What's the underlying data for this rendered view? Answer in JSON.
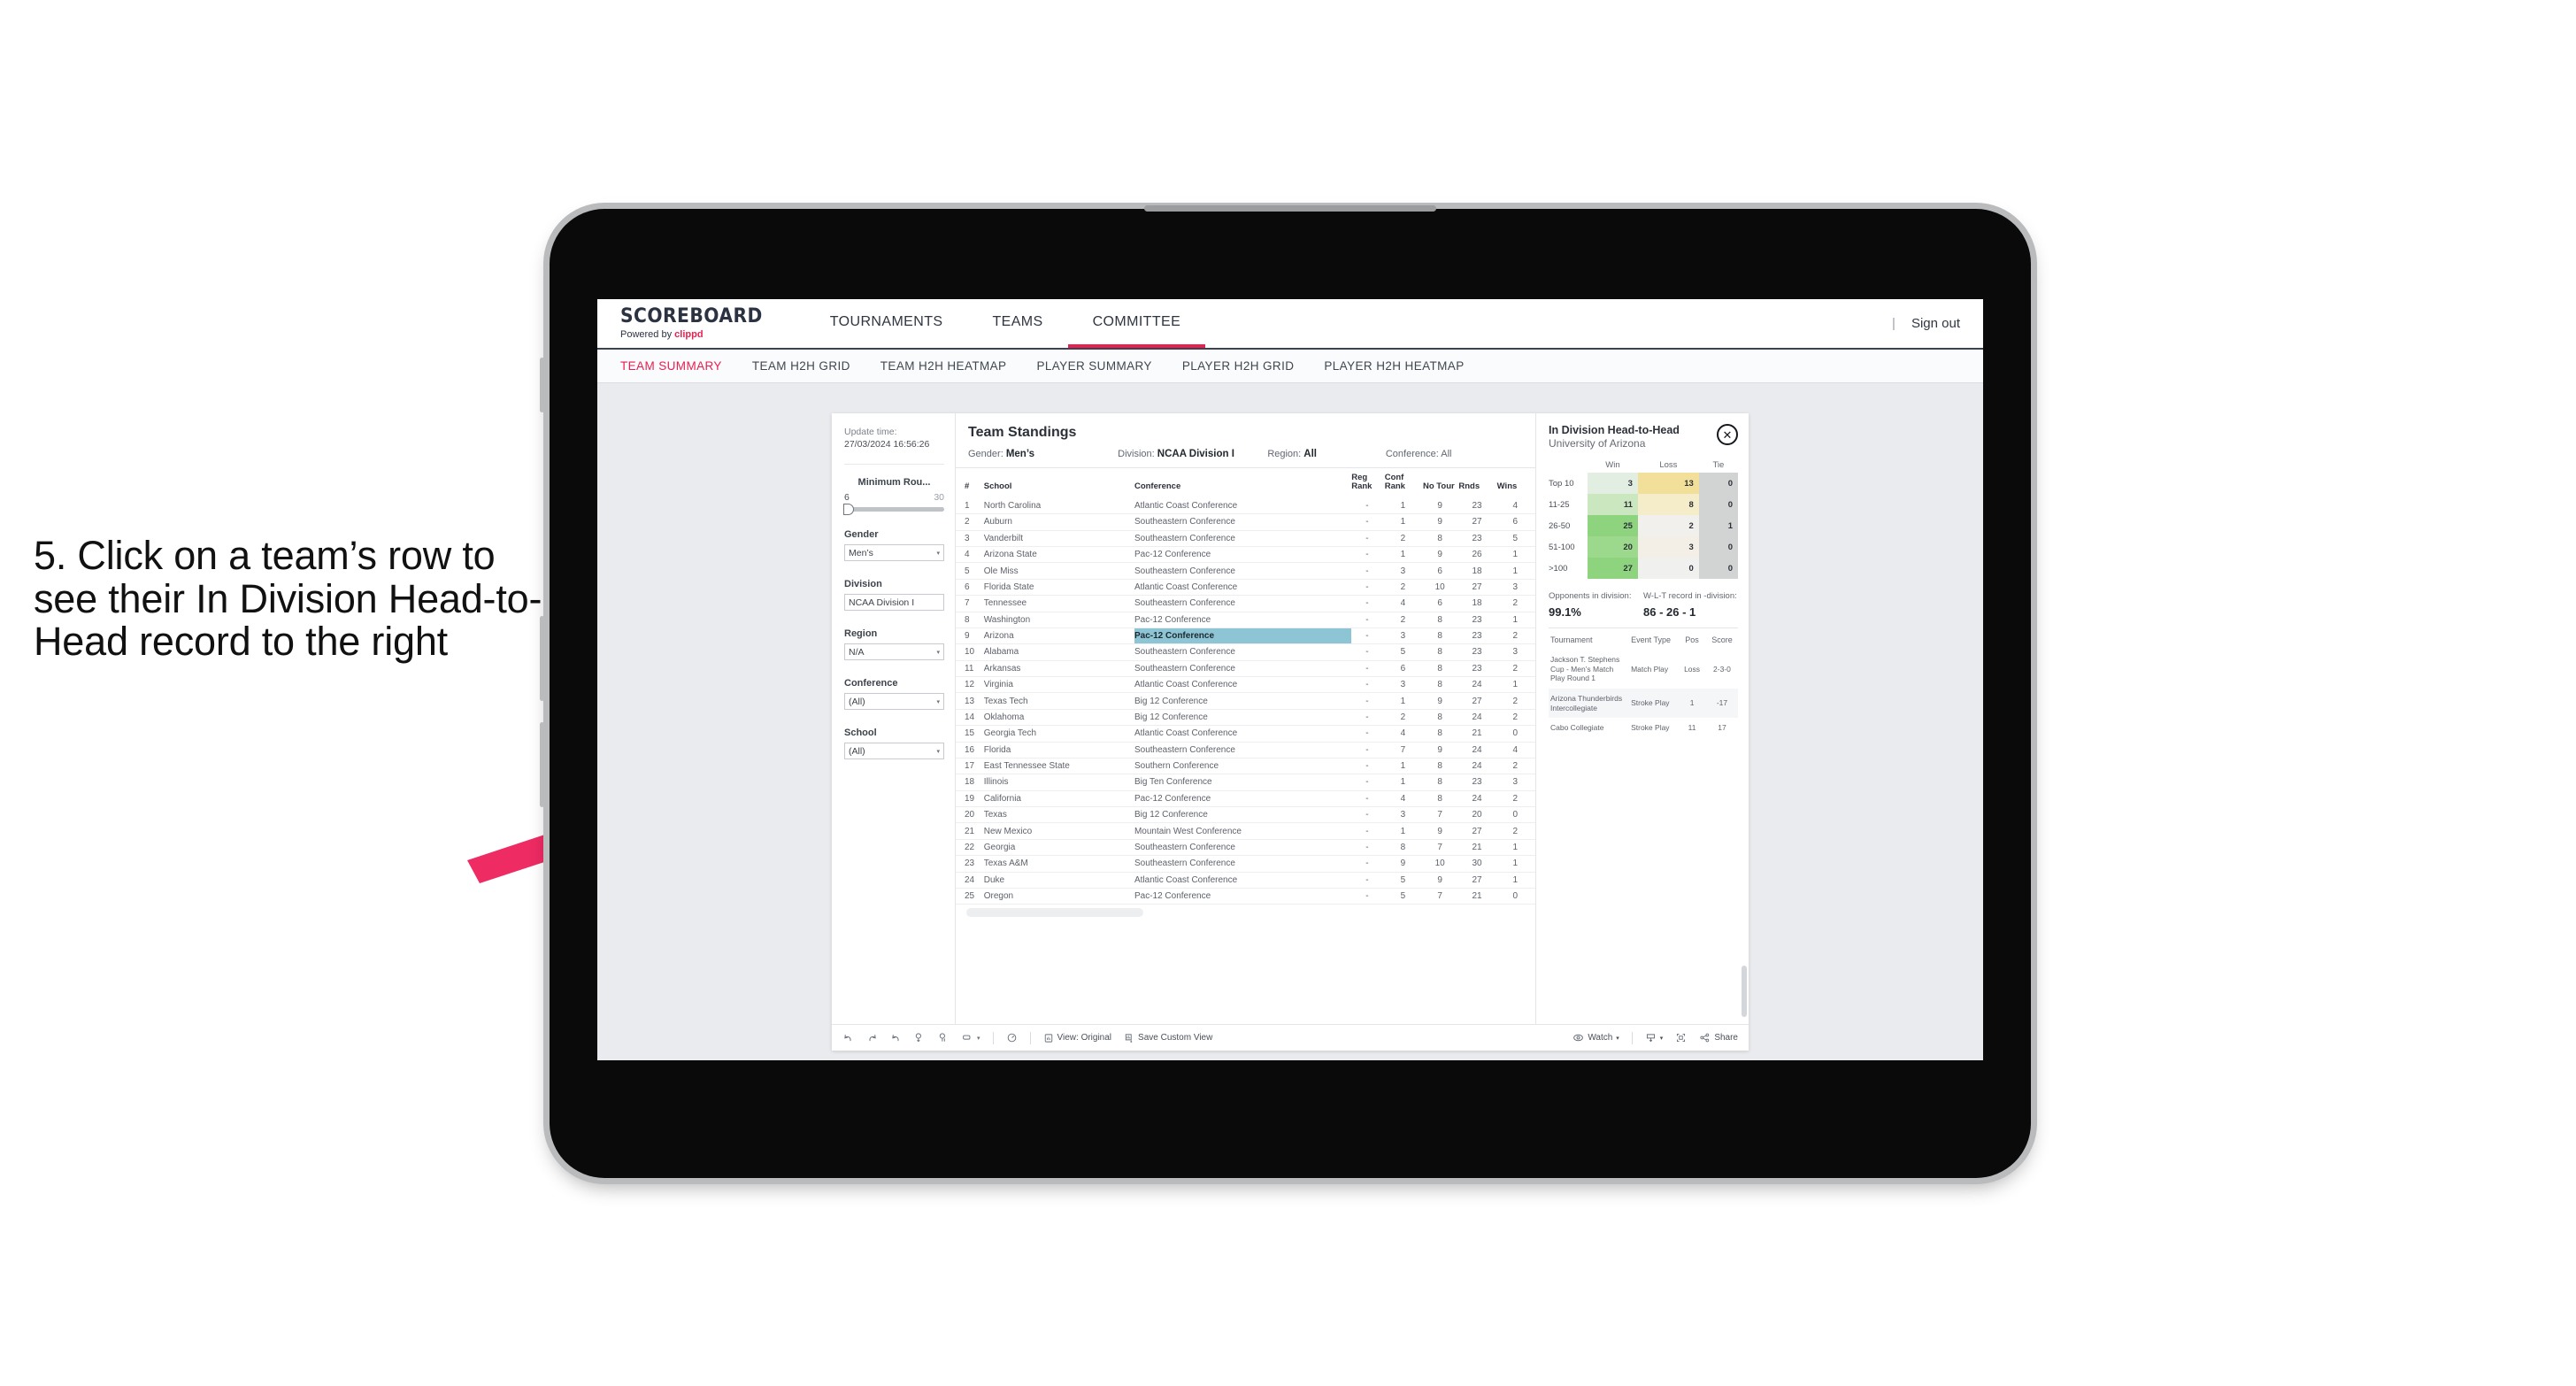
{
  "caption": "5. Click on a team’s row to see their In Division Head-to-Head record to the right",
  "header": {
    "logo_word": "SCOREBOARD",
    "logo_powered": "Powered by ",
    "logo_brand": "clippd",
    "nav": [
      {
        "label": "TOURNAMENTS",
        "active": false
      },
      {
        "label": "TEAMS",
        "active": false
      },
      {
        "label": "COMMITTEE",
        "active": true
      }
    ],
    "separator": "|",
    "signout": "Sign out"
  },
  "subtabs": [
    {
      "label": "TEAM SUMMARY",
      "active": true
    },
    {
      "label": "TEAM H2H GRID",
      "active": false
    },
    {
      "label": "TEAM H2H HEATMAP",
      "active": false
    },
    {
      "label": "PLAYER SUMMARY",
      "active": false
    },
    {
      "label": "PLAYER H2H GRID",
      "active": false
    },
    {
      "label": "PLAYER H2H HEATMAP",
      "active": false
    }
  ],
  "filters": {
    "update_label": "Update time:",
    "update_value": "27/03/2024 16:56:26",
    "slider": {
      "title": "Minimum Rou...",
      "min": "6",
      "max": "30"
    },
    "groups": [
      {
        "title": "Gender",
        "value": "Men’s"
      },
      {
        "title": "Division",
        "value": "NCAA Division I"
      },
      {
        "title": "Region",
        "value": "N/A"
      },
      {
        "title": "Conference",
        "value": "(All)"
      },
      {
        "title": "School",
        "value": "(All)"
      }
    ],
    "caret": "▾"
  },
  "standings": {
    "title": "Team Standings",
    "filters": [
      {
        "label": "Gender: ",
        "value": "Men’s"
      },
      {
        "label": "Division: ",
        "value": "NCAA Division I"
      },
      {
        "label": "Region: ",
        "value": "All"
      },
      {
        "label": "Conference: ",
        "value": "All"
      }
    ],
    "columns": [
      "#",
      "School",
      "Conference",
      "Reg Rank",
      "Conf Rank",
      "No Tour",
      "Rnds",
      "Wins"
    ],
    "selected_row": 9,
    "rows": [
      {
        "num": "1",
        "school": "North Carolina",
        "conf": "Atlantic Coast Conference",
        "reg": "-",
        "cr": "1",
        "nt": "9",
        "rn": "23",
        "wi": "4"
      },
      {
        "num": "2",
        "school": "Auburn",
        "conf": "Southeastern Conference",
        "reg": "-",
        "cr": "1",
        "nt": "9",
        "rn": "27",
        "wi": "6"
      },
      {
        "num": "3",
        "school": "Vanderbilt",
        "conf": "Southeastern Conference",
        "reg": "-",
        "cr": "2",
        "nt": "8",
        "rn": "23",
        "wi": "5"
      },
      {
        "num": "4",
        "school": "Arizona State",
        "conf": "Pac-12 Conference",
        "reg": "-",
        "cr": "1",
        "nt": "9",
        "rn": "26",
        "wi": "1"
      },
      {
        "num": "5",
        "school": "Ole Miss",
        "conf": "Southeastern Conference",
        "reg": "-",
        "cr": "3",
        "nt": "6",
        "rn": "18",
        "wi": "1"
      },
      {
        "num": "6",
        "school": "Florida State",
        "conf": "Atlantic Coast Conference",
        "reg": "-",
        "cr": "2",
        "nt": "10",
        "rn": "27",
        "wi": "3"
      },
      {
        "num": "7",
        "school": "Tennessee",
        "conf": "Southeastern Conference",
        "reg": "-",
        "cr": "4",
        "nt": "6",
        "rn": "18",
        "wi": "2"
      },
      {
        "num": "8",
        "school": "Washington",
        "conf": "Pac-12 Conference",
        "reg": "-",
        "cr": "2",
        "nt": "8",
        "rn": "23",
        "wi": "1"
      },
      {
        "num": "9",
        "school": "Arizona",
        "conf": "Pac-12 Conference",
        "reg": "-",
        "cr": "3",
        "nt": "8",
        "rn": "23",
        "wi": "2"
      },
      {
        "num": "10",
        "school": "Alabama",
        "conf": "Southeastern Conference",
        "reg": "-",
        "cr": "5",
        "nt": "8",
        "rn": "23",
        "wi": "3"
      },
      {
        "num": "11",
        "school": "Arkansas",
        "conf": "Southeastern Conference",
        "reg": "-",
        "cr": "6",
        "nt": "8",
        "rn": "23",
        "wi": "2"
      },
      {
        "num": "12",
        "school": "Virginia",
        "conf": "Atlantic Coast Conference",
        "reg": "-",
        "cr": "3",
        "nt": "8",
        "rn": "24",
        "wi": "1"
      },
      {
        "num": "13",
        "school": "Texas Tech",
        "conf": "Big 12 Conference",
        "reg": "-",
        "cr": "1",
        "nt": "9",
        "rn": "27",
        "wi": "2"
      },
      {
        "num": "14",
        "school": "Oklahoma",
        "conf": "Big 12 Conference",
        "reg": "-",
        "cr": "2",
        "nt": "8",
        "rn": "24",
        "wi": "2"
      },
      {
        "num": "15",
        "school": "Georgia Tech",
        "conf": "Atlantic Coast Conference",
        "reg": "-",
        "cr": "4",
        "nt": "8",
        "rn": "21",
        "wi": "0"
      },
      {
        "num": "16",
        "school": "Florida",
        "conf": "Southeastern Conference",
        "reg": "-",
        "cr": "7",
        "nt": "9",
        "rn": "24",
        "wi": "4"
      },
      {
        "num": "17",
        "school": "East Tennessee State",
        "conf": "Southern Conference",
        "reg": "-",
        "cr": "1",
        "nt": "8",
        "rn": "24",
        "wi": "2"
      },
      {
        "num": "18",
        "school": "Illinois",
        "conf": "Big Ten Conference",
        "reg": "-",
        "cr": "1",
        "nt": "8",
        "rn": "23",
        "wi": "3"
      },
      {
        "num": "19",
        "school": "California",
        "conf": "Pac-12 Conference",
        "reg": "-",
        "cr": "4",
        "nt": "8",
        "rn": "24",
        "wi": "2"
      },
      {
        "num": "20",
        "school": "Texas",
        "conf": "Big 12 Conference",
        "reg": "-",
        "cr": "3",
        "nt": "7",
        "rn": "20",
        "wi": "0"
      },
      {
        "num": "21",
        "school": "New Mexico",
        "conf": "Mountain West Conference",
        "reg": "-",
        "cr": "1",
        "nt": "9",
        "rn": "27",
        "wi": "2"
      },
      {
        "num": "22",
        "school": "Georgia",
        "conf": "Southeastern Conference",
        "reg": "-",
        "cr": "8",
        "nt": "7",
        "rn": "21",
        "wi": "1"
      },
      {
        "num": "23",
        "school": "Texas A&M",
        "conf": "Southeastern Conference",
        "reg": "-",
        "cr": "9",
        "nt": "10",
        "rn": "30",
        "wi": "1"
      },
      {
        "num": "24",
        "school": "Duke",
        "conf": "Atlantic Coast Conference",
        "reg": "-",
        "cr": "5",
        "nt": "9",
        "rn": "27",
        "wi": "1"
      },
      {
        "num": "25",
        "school": "Oregon",
        "conf": "Pac-12 Conference",
        "reg": "-",
        "cr": "5",
        "nt": "7",
        "rn": "21",
        "wi": "0"
      }
    ]
  },
  "h2h": {
    "title": "In Division Head-to-Head",
    "subtitle": "University of Arizona",
    "close_icon": "✕",
    "chart_data": {
      "type": "heatmap",
      "title": "In Division Head-to-Head",
      "columns": [
        "Win",
        "Loss",
        "Tie"
      ],
      "categories": [
        "Top 10",
        "11-25",
        "26-50",
        "51-100",
        ">100"
      ],
      "values": [
        [
          3,
          13,
          0
        ],
        [
          11,
          8,
          0
        ],
        [
          25,
          2,
          1
        ],
        [
          20,
          3,
          0
        ],
        [
          27,
          0,
          0
        ]
      ],
      "cell_colors": [
        [
          "#e3eee2",
          "#f2e09a",
          "#d2d3d3"
        ],
        [
          "#cbe7c0",
          "#f5ecc9",
          "#d2d3d3"
        ],
        [
          "#8ed47f",
          "#f1f0ec",
          "#d2d3d3"
        ],
        [
          "#9cd98c",
          "#f4 efe6",
          "#d2d3d3"
        ],
        [
          "#8ed47f",
          "#f0f0ee",
          "#d2d3d3"
        ]
      ]
    },
    "stats": [
      {
        "label": "Opponents in division:",
        "value": "99.1%"
      },
      {
        "label": "W-L-T record in -division:",
        "value": "86 - 26 - 1"
      }
    ],
    "tour_columns": [
      "Tournament",
      "Event Type",
      "Pos",
      "Score"
    ],
    "tour_rows": [
      {
        "name": "Jackson T. Stephens Cup - Men’s Match Play Round 1",
        "type": "Match Play",
        "pos": "Loss",
        "score": "2-3-0"
      },
      {
        "name": "Arizona Thunderbirds Intercollegiate",
        "type": "Stroke Play",
        "pos": "1",
        "score": "-17"
      },
      {
        "name": "Cabo Collegiate",
        "type": "Stroke Play",
        "pos": "11",
        "score": "17"
      }
    ]
  },
  "toolbar": {
    "view_label": "View: Original",
    "save_label": "Save Custom View",
    "watch_label": "Watch",
    "share_label": "Share",
    "caret": "▾"
  }
}
